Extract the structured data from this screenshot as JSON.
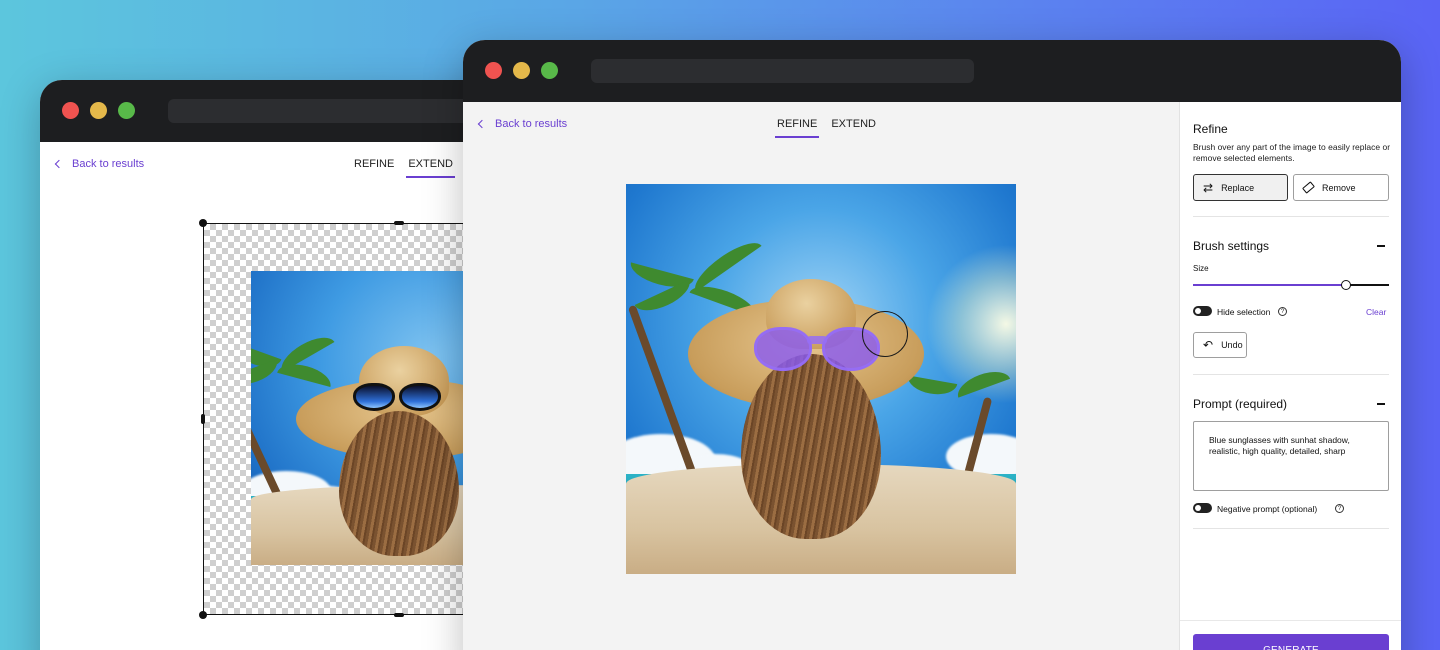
{
  "back_window": {
    "back_link": "Back to results",
    "tabs": [
      {
        "label": "REFINE",
        "active": false
      },
      {
        "label": "EXTEND",
        "active": true
      }
    ]
  },
  "front_window": {
    "back_link": "Back to results",
    "tabs": [
      {
        "label": "REFINE",
        "active": true
      },
      {
        "label": "EXTEND",
        "active": false
      }
    ],
    "panel": {
      "refine": {
        "title": "Refine",
        "description": "Brush over any part of the image to easily replace or remove selected elements.",
        "replace_label": "Replace",
        "remove_label": "Remove",
        "selected_mode": "Replace"
      },
      "brush": {
        "title": "Brush settings",
        "size_label": "Size",
        "size_value": 0.78,
        "hide_selection_label": "Hide selection",
        "clear_label": "Clear",
        "undo_label": "Undo"
      },
      "prompt": {
        "title": "Prompt (required)",
        "value": "Blue sunglasses with sunhat shadow, realistic, high quality, detailed, sharp",
        "negative_label": "Negative prompt (optional)"
      },
      "generate_label": "GENERATE"
    }
  },
  "colors": {
    "accent": "#6a3fd1",
    "mask": "#8a5cf0",
    "titlebar": "#1d1e20"
  },
  "icons": [
    "chevron-left-icon",
    "swap-arrows-icon",
    "eraser-icon",
    "undo-arrow-icon",
    "minus-icon",
    "help-circle-icon"
  ]
}
